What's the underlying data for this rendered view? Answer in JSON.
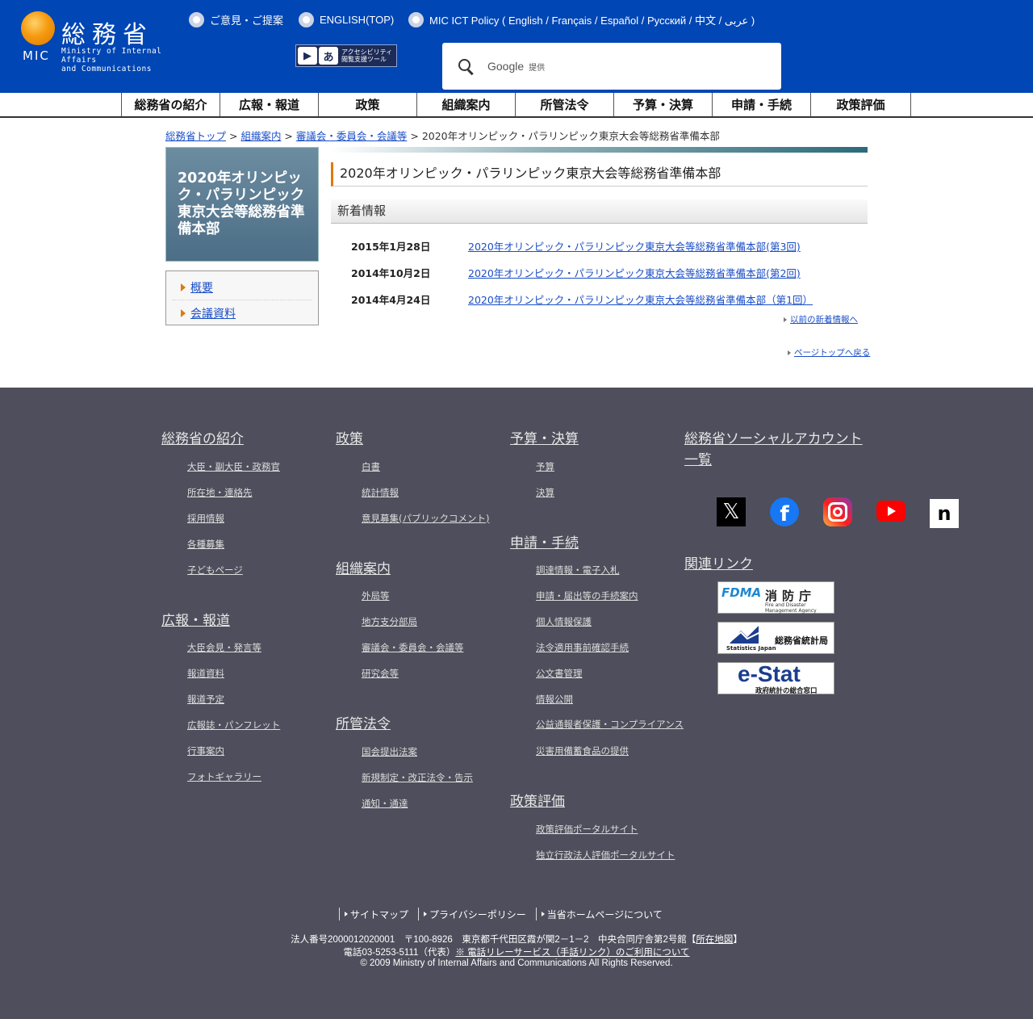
{
  "header": {
    "logo_kanji": "総務省",
    "logo_mic": "MIC",
    "logo_en_line1": "Ministry of Internal Affairs",
    "logo_en_line2": "and Communications",
    "top_links": [
      "ご意見・ご提案",
      "ENGLISH(TOP)",
      "MIC ICT Policy ( English / Français / Español / Русский / 中文 / عربى )"
    ],
    "accessibility_line1": "アクセシビリティ",
    "accessibility_line2": "閲覧支援ツール",
    "search_brand": "Google",
    "search_provided": "提供"
  },
  "nav": [
    "総務省の紹介",
    "広報・報道",
    "政策",
    "組織案内",
    "所管法令",
    "予算・決算",
    "申請・手続",
    "政策評価"
  ],
  "breadcrumb": {
    "items": [
      "総務省トップ",
      "組織案内",
      "審議会・委員会・会議等"
    ],
    "current": "2020年オリンピック・パラリンピック東京大会等総務省準備本部",
    "sep": " > "
  },
  "sidebar": {
    "title": "2020年オリンピック・パラリンピック東京大会等総務省準備本部",
    "items": [
      "概要",
      "会議資料"
    ]
  },
  "main": {
    "title": "2020年オリンピック・パラリンピック東京大会等総務省準備本部",
    "news_heading": "新着情報",
    "news": [
      {
        "date": "2015年1月28日",
        "title": "2020年オリンピック・パラリンピック東京大会等総務省準備本部(第3回)"
      },
      {
        "date": "2014年10月2日",
        "title": "2020年オリンピック・パラリンピック東京大会等総務省準備本部(第2回)"
      },
      {
        "date": "2014年4月24日",
        "title": "2020年オリンピック・パラリンピック東京大会等総務省準備本部（第1回）"
      }
    ],
    "older_news": "以前の新着情報へ",
    "page_top": "ページトップへ戻る"
  },
  "footer": {
    "col1": [
      {
        "heading": "総務省の紹介",
        "links": [
          "大臣・副大臣・政務官",
          "所在地・連絡先",
          "採用情報",
          "各種募集",
          "子どもページ"
        ]
      },
      {
        "heading": "広報・報道",
        "links": [
          "大臣会見・発言等",
          "報道資料",
          "報道予定",
          "広報誌・パンフレット",
          "行事案内",
          "フォトギャラリー"
        ]
      }
    ],
    "col2": [
      {
        "heading": "政策",
        "links": [
          "白書",
          "統計情報",
          "意見募集(パブリックコメント)"
        ]
      },
      {
        "heading": "組織案内",
        "links": [
          "外局等",
          "地方支分部局",
          "審議会・委員会・会議等",
          "研究会等"
        ]
      },
      {
        "heading": "所管法令",
        "links": [
          "国会提出法案",
          "新規制定・改正法令・告示",
          "通知・通達"
        ]
      }
    ],
    "col3": [
      {
        "heading": "予算・決算",
        "links": [
          "予算",
          "決算"
        ]
      },
      {
        "heading": "申請・手続",
        "links": [
          "調達情報・電子入札",
          "申請・届出等の手続案内",
          "個人情報保護",
          "法令適用事前確認手続",
          "公文書管理",
          "情報公開",
          "公益通報者保護・コンプライアンス",
          "災害用備蓄食品の提供"
        ]
      },
      {
        "heading": "政策評価",
        "links": [
          "政策評価ポータルサイト",
          "独立行政法人評価ポータルサイト"
        ]
      }
    ],
    "social_heading": "総務省ソーシャルアカウント一覧",
    "related_heading": "関連リンク",
    "banners": {
      "fdma_en": "FDMA",
      "fdma_jp": "消防庁",
      "fdma_sub": "Fire and Disaster Management Agency",
      "stat_jp": "総務省統計局",
      "stat_en": "Statistics Japan",
      "estat": "e-Stat",
      "estat_sub": "政府統計の総合窓口"
    },
    "bottom_links": [
      "サイトマップ",
      "プライバシーポリシー",
      "当省ホームページについて"
    ],
    "address_prefix": "法人番号2000012020001　〒100-8926　東京都千代田区霞が関2－1－2　中央合同庁舎第2号館【",
    "address_link": "所在地図",
    "address_suffix": "】",
    "phone": "電話03-5253-5111（代表）",
    "relay_link": "※ 電話リレーサービス（手話リンク）のご利用について",
    "copyright": "© 2009 Ministry of Internal Affairs and Communications All Rights Reserved."
  }
}
